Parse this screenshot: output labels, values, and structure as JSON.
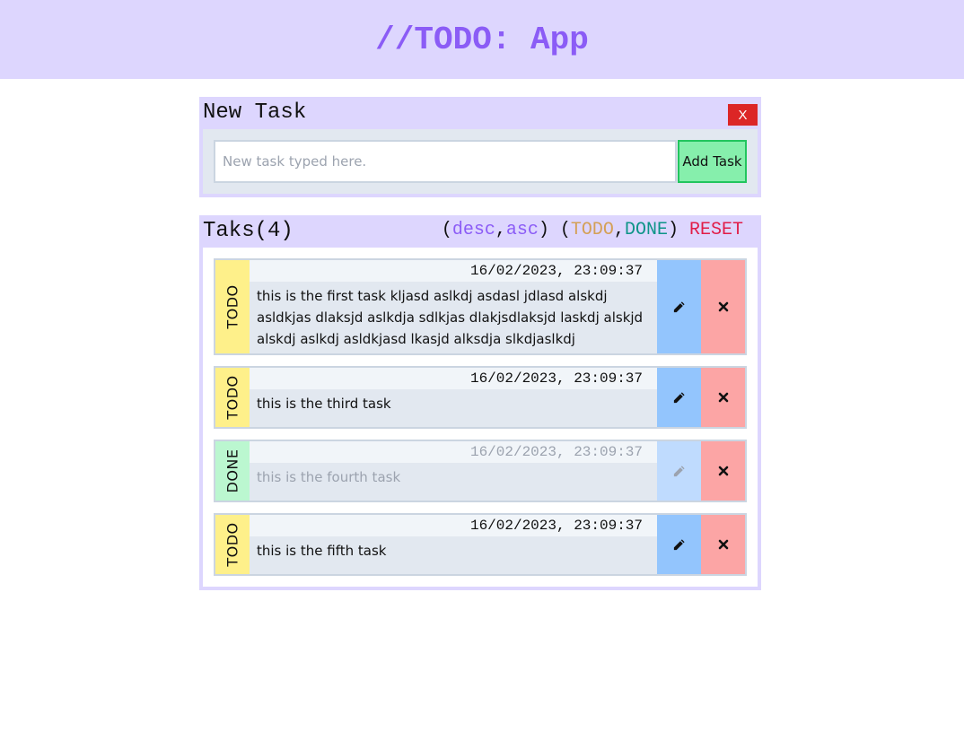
{
  "header": {
    "title": "//TODO: App"
  },
  "new_task": {
    "title": "New Task",
    "close_label": "X",
    "input_placeholder": "New task typed here.",
    "input_value": "",
    "add_label": "Add Task"
  },
  "tasks_panel": {
    "title": "Taks(4)",
    "sort": {
      "open1": "(",
      "desc": "desc",
      "comma1": ",",
      "asc": "asc",
      "close1": ")",
      "open2": " (",
      "todo": "TODO",
      "comma2": ",",
      "done": "DONE",
      "close2": ")",
      "reset": " RESET"
    }
  },
  "tasks": [
    {
      "status": "TODO",
      "date": "16/02/2023, 23:09:37",
      "text": "this is the first task kljasd aslkdj asdasl jdlasd alskdj asldkjas dlaksjd aslkdja sdlkjas dlakjsdlaksjd laskdj alskjd alskdj aslkdj asldkjasd lkasjd alksdja slkdjaslkdj"
    },
    {
      "status": "TODO",
      "date": "16/02/2023, 23:09:37",
      "text": "this is the third task"
    },
    {
      "status": "DONE",
      "date": "16/02/2023, 23:09:37",
      "text": "this is the fourth task"
    },
    {
      "status": "TODO",
      "date": "16/02/2023, 23:09:37",
      "text": "this is the fifth task"
    }
  ],
  "icons": {
    "edit": "pencil-icon",
    "delete": "close-icon"
  },
  "colors": {
    "accent": "#8b5cf6",
    "panel": "#ddd6fe",
    "todo": "#fef08a",
    "done": "#bbf7d0",
    "edit": "#93c5fd",
    "delete": "#fca5a5",
    "danger": "#dc2626"
  }
}
